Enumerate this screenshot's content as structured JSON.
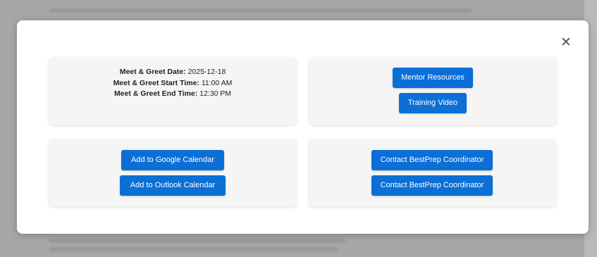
{
  "modal": {
    "close_glyph": "✕",
    "meet_greet": {
      "date_label": "Meet & Greet Date:",
      "date_value": "2025-12-18",
      "start_label": "Meet & Greet Start Time:",
      "start_value": "11:00 AM",
      "end_label": "Meet & Greet End Time:",
      "end_value": "12:30 PM"
    },
    "resources": {
      "mentor_resources_label": "Mentor Resources",
      "training_video_label": "Training Video"
    },
    "calendar": {
      "google_label": "Add to Google Calendar",
      "outlook_label": "Add to Outlook Calendar"
    },
    "contact": {
      "coordinator_label_1": "Contact BestPrep Coordinator",
      "coordinator_label_2": "Contact BestPrep Coordinator"
    }
  },
  "colors": {
    "button_primary": "#0b6fd6",
    "card_background": "#f5f5f5",
    "overlay": "#a7a7a7"
  }
}
